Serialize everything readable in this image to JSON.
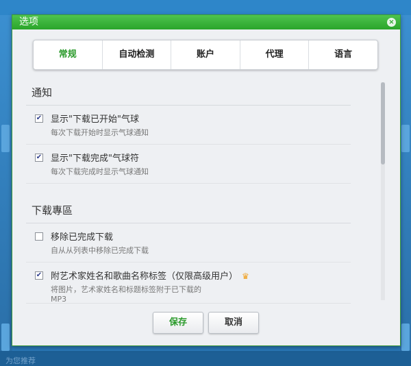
{
  "dialog": {
    "title": "选项",
    "close_glyph": "×"
  },
  "tabs": [
    {
      "label": "常规",
      "active": true
    },
    {
      "label": "自动检测",
      "active": false
    },
    {
      "label": "账户",
      "active": false
    },
    {
      "label": "代理",
      "active": false
    },
    {
      "label": "语言",
      "active": false
    }
  ],
  "sections": {
    "notify": {
      "title": "通知",
      "options": [
        {
          "label": "显示\"下载已开始\"气球",
          "desc": "每次下载开始时显示气球通知",
          "checked": true
        },
        {
          "label": "显示\"下载完成\"气球符",
          "desc": "每次下载完成时显示气球通知",
          "checked": true
        }
      ]
    },
    "download": {
      "title": "下载專區",
      "options": [
        {
          "label": "移除已完成下载",
          "desc": "自从从列表中移除已完成下载",
          "checked": false
        },
        {
          "label": "附艺术家姓名和歌曲名称标签（仅限高级用户）",
          "desc": "将图片，艺术家姓名和标题标签附于已下载的MP3",
          "checked": true,
          "badge": "crown-icon"
        }
      ]
    }
  },
  "buttons": {
    "save": "保存",
    "cancel": "取消"
  },
  "background": {
    "footer_text": "为您推荐"
  },
  "colors": {
    "accent": "#2a9a2a",
    "titlebar": "#3db53d"
  }
}
